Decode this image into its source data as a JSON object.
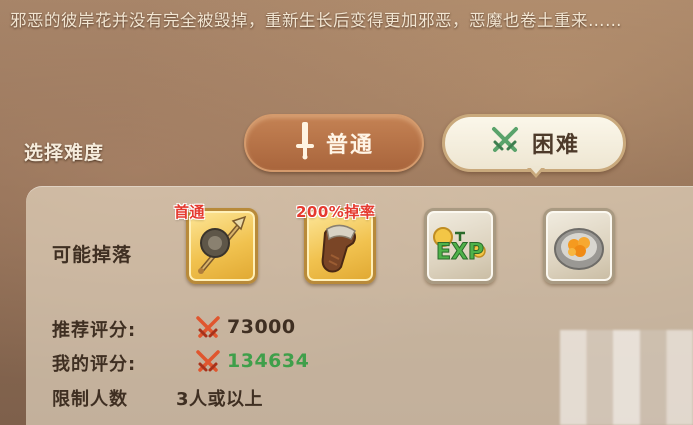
{
  "description": "邪恶的彼岸花并没有完全被毁掉，重新生长后变得更加邪恶，恶魔也卷土重来……",
  "difficulty": {
    "label": "选择难度",
    "tabs": [
      {
        "label": "普通",
        "icon": "sword-icon",
        "selected": false
      },
      {
        "label": "困难",
        "icon": "crossed-swords-icon",
        "selected": true
      }
    ]
  },
  "drops": {
    "label": "可能掉落",
    "items": [
      {
        "name": "staff-weapon",
        "icon": "staff-icon",
        "frame": "gold",
        "tag": "首通"
      },
      {
        "name": "gauntlet",
        "icon": "gauntlet-icon",
        "frame": "gold",
        "tag": "200%掉率"
      },
      {
        "name": "exp",
        "icon": "exp-icon",
        "frame": "stone",
        "tag": ""
      },
      {
        "name": "food-plate",
        "icon": "food-plate-icon",
        "frame": "stone",
        "tag": ""
      }
    ]
  },
  "stats": {
    "recommended_label": "推荐评分:",
    "recommended_value": "73000",
    "mine_label": "我的评分:",
    "mine_value": "134634",
    "limit_label": "限制人数",
    "limit_value": "3人或以上"
  },
  "colors": {
    "tag_red": "#e53a2f",
    "my_score_green": "#3f9f4a",
    "rec_score": "#3f2f22"
  }
}
